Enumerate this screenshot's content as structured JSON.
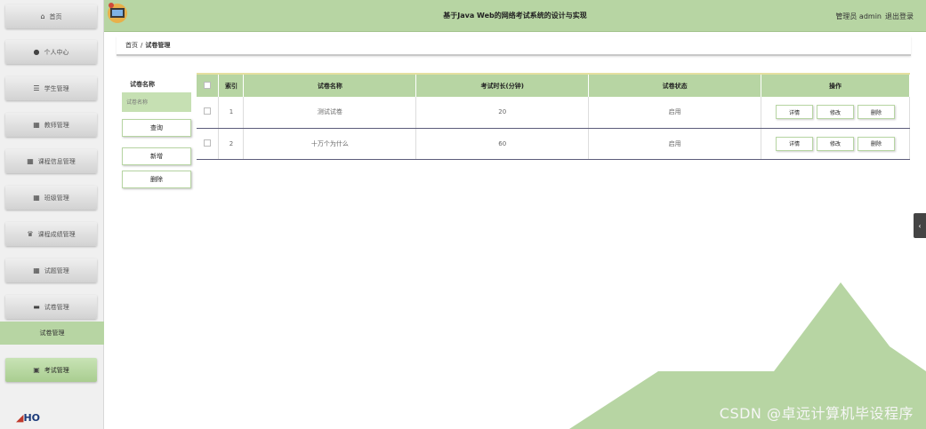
{
  "header": {
    "title": "基于Java Web的网络考试系统的设计与实现",
    "user_label": "管理员 admin",
    "logout": "退出登录"
  },
  "sidebar": {
    "items": [
      {
        "label": "首页",
        "icon": "home-icon",
        "glyph": "⌂"
      },
      {
        "label": "个人中心",
        "icon": "user-icon",
        "glyph": "👤"
      },
      {
        "label": "学生管理",
        "icon": "list-icon",
        "glyph": "☰"
      },
      {
        "label": "教师管理",
        "icon": "grid-icon",
        "glyph": "▦"
      },
      {
        "label": "课程信息管理",
        "icon": "grid-icon",
        "glyph": "▦"
      },
      {
        "label": "班级管理",
        "icon": "grid-icon",
        "glyph": "▦"
      },
      {
        "label": "课程成绩管理",
        "icon": "trophy-icon",
        "glyph": "♛"
      },
      {
        "label": "试题管理",
        "icon": "grid-icon",
        "glyph": "▦"
      },
      {
        "label": "试卷管理",
        "icon": "monitor-icon",
        "glyph": "▬"
      }
    ],
    "sub_header": "试卷管理",
    "active_item": {
      "label": "考试管理",
      "icon": "clipboard-icon",
      "glyph": "▣"
    },
    "logo_text": "HO"
  },
  "breadcrumb": {
    "home": "首页",
    "separator": "/",
    "current": "试卷管理"
  },
  "form": {
    "label": "试卷名称",
    "placeholder": "试卷名称",
    "search_button": "查询",
    "add_button": "新增",
    "delete_button": "删除"
  },
  "table": {
    "headers": [
      "索引",
      "试卷名称",
      "考试时长(分钟)",
      "试卷状态",
      "操作"
    ],
    "rows": [
      {
        "index": "1",
        "name": "测试试卷",
        "duration": "20",
        "status": "启用"
      },
      {
        "index": "2",
        "name": "十万个为什么",
        "duration": "60",
        "status": "启用"
      }
    ],
    "actions": {
      "detail": "详情",
      "edit": "修改",
      "delete": "删除"
    }
  },
  "watermark": "CSDN @卓远计算机毕设程序",
  "colors": {
    "accent": "#b7d5a3",
    "header": "#b7d5a3"
  }
}
